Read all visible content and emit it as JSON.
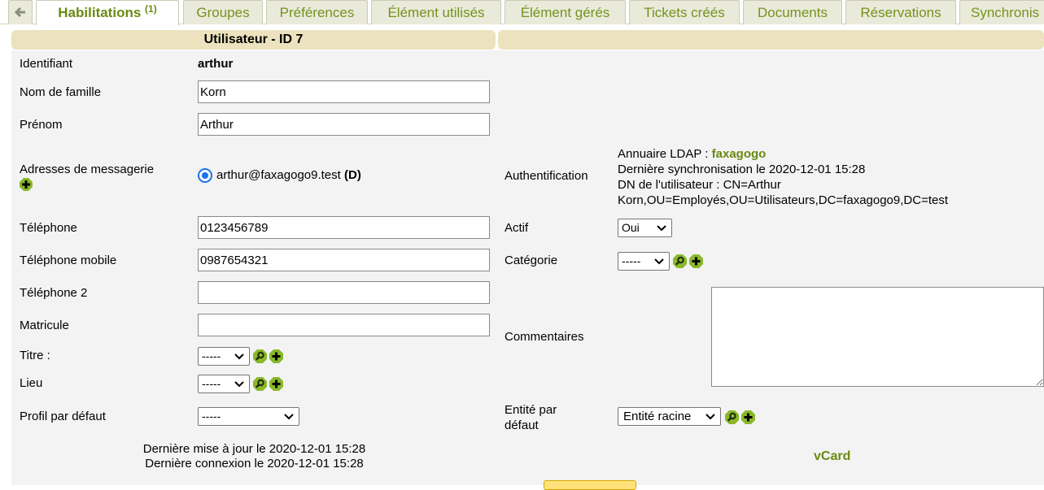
{
  "tabs": {
    "back_icon": "arrow-left-icon",
    "items": [
      {
        "label": "Habilitations",
        "badge": "(1)",
        "active": true
      },
      {
        "label": "Groupes"
      },
      {
        "label": "Préférences"
      },
      {
        "label": "Élément utilisés"
      },
      {
        "label": "Élément gérés"
      },
      {
        "label": "Tickets créés"
      },
      {
        "label": "Documents"
      },
      {
        "label": "Réservations"
      },
      {
        "label": "Synchronis"
      }
    ]
  },
  "header": {
    "title": "Utilisateur - ID 7"
  },
  "form": {
    "identifiant": {
      "label": "Identifiant",
      "value": "arthur"
    },
    "nom": {
      "label": "Nom de famille",
      "value": "Korn"
    },
    "prenom": {
      "label": "Prénom",
      "value": "Arthur"
    },
    "emails": {
      "label": "Adresses de messagerie",
      "value": "arthur@faxagogo9.test",
      "default_tag": "(D)"
    },
    "telephone": {
      "label": "Téléphone",
      "value": "0123456789"
    },
    "mobile": {
      "label": "Téléphone mobile",
      "value": "0987654321"
    },
    "telephone2": {
      "label": "Téléphone 2",
      "value": ""
    },
    "matricule": {
      "label": "Matricule",
      "value": ""
    },
    "titre": {
      "label": "Titre :",
      "selected": "-----"
    },
    "lieu": {
      "label": "Lieu",
      "selected": "-----"
    },
    "profil": {
      "label": "Profil par défaut",
      "selected": "-----"
    },
    "auth": {
      "label": "Authentification",
      "annuaire_prefix": "Annuaire LDAP : ",
      "annuaire": "faxagogo",
      "sync": "Dernière synchronisation le 2020-12-01 15:28",
      "dn_line1": "DN de l'utilisateur : CN=Arthur",
      "dn_line2": "Korn,OU=Employés,OU=Utilisateurs,DC=faxagogo9,DC=test"
    },
    "actif": {
      "label": "Actif",
      "selected": "Oui"
    },
    "categorie": {
      "label": "Catégorie",
      "selected": "-----"
    },
    "commentaires": {
      "label": "Commentaires",
      "value": ""
    },
    "entite": {
      "label_line1": "Entité par",
      "label_line2": "défaut",
      "selected": "Entité racine"
    },
    "last_update": "Dernière mise à jour le 2020-12-01 15:28",
    "last_login": "Dernière connexion le 2020-12-01 15:28",
    "vcard": "vCard"
  },
  "colors": {
    "accent": "#6a8a12",
    "header_bg": "#ece2bd",
    "tab_bg": "#e9ead9",
    "add_icon": "#8ab82a"
  }
}
